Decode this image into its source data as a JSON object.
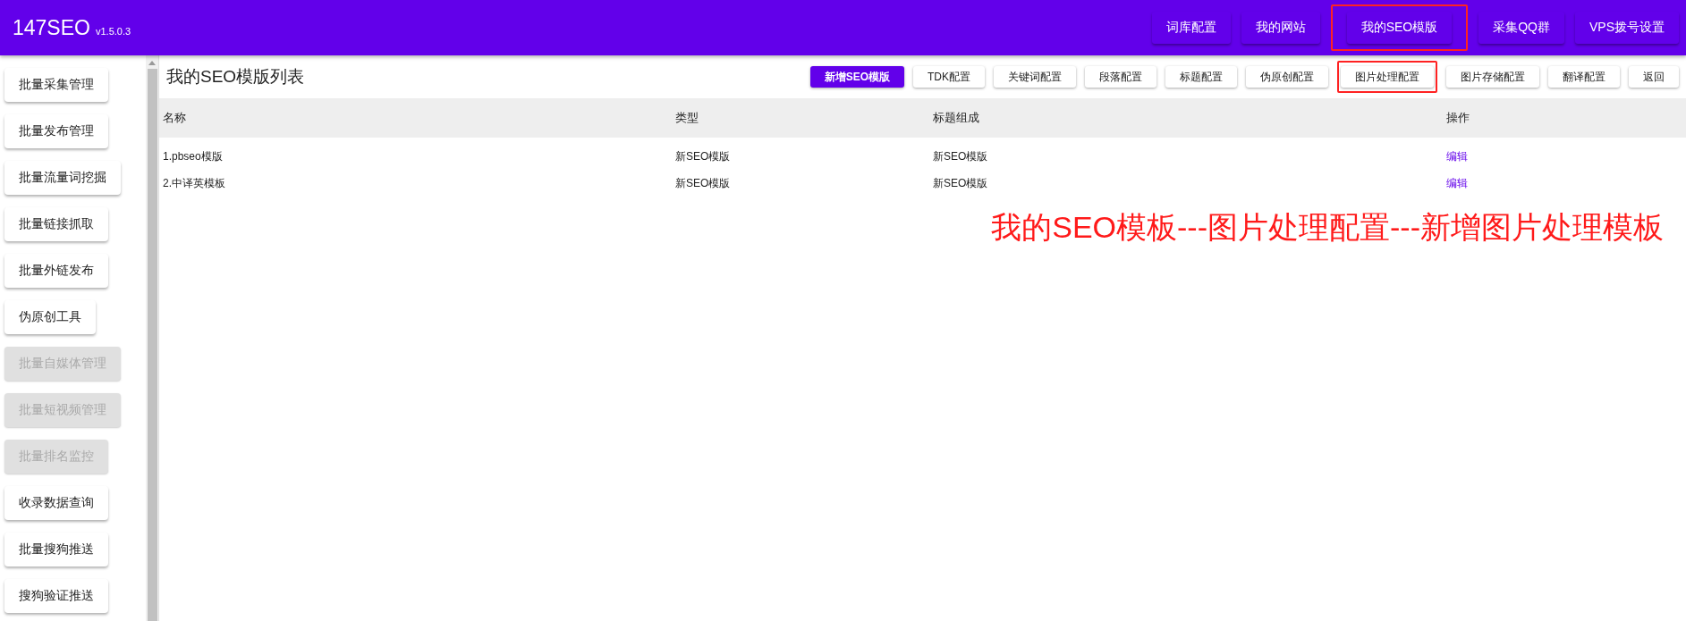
{
  "app": {
    "name": "147SEO",
    "version": "v1.5.0.3"
  },
  "nav": [
    {
      "label": "词库配置",
      "highlighted": false
    },
    {
      "label": "我的网站",
      "highlighted": false
    },
    {
      "label": "我的SEO模版",
      "highlighted": true
    },
    {
      "label": "采集QQ群",
      "highlighted": false
    },
    {
      "label": "VPS拨号设置",
      "highlighted": false
    }
  ],
  "sidebar": {
    "items": [
      {
        "label": "批量采集管理",
        "disabled": false
      },
      {
        "label": "批量发布管理",
        "disabled": false
      },
      {
        "label": "批量流量词挖掘",
        "disabled": false
      },
      {
        "label": "批量链接抓取",
        "disabled": false
      },
      {
        "label": "批量外链发布",
        "disabled": false
      },
      {
        "label": "伪原创工具",
        "disabled": false
      },
      {
        "label": "批量自媒体管理",
        "disabled": true
      },
      {
        "label": "批量短视频管理",
        "disabled": true
      },
      {
        "label": "批量排名监控",
        "disabled": true
      },
      {
        "label": "收录数据查询",
        "disabled": false
      },
      {
        "label": "批量搜狗推送",
        "disabled": false
      },
      {
        "label": "搜狗验证推送",
        "disabled": false
      }
    ]
  },
  "page_title": "我的SEO模版列表",
  "toolbar": [
    {
      "label": "新增SEO模版",
      "kind": "primary",
      "highlighted": false
    },
    {
      "label": "TDK配置",
      "kind": "plain",
      "highlighted": false
    },
    {
      "label": "关键词配置",
      "kind": "plain",
      "highlighted": false
    },
    {
      "label": "段落配置",
      "kind": "plain",
      "highlighted": false
    },
    {
      "label": "标题配置",
      "kind": "plain",
      "highlighted": false
    },
    {
      "label": "伪原创配置",
      "kind": "plain",
      "highlighted": false
    },
    {
      "label": "图片处理配置",
      "kind": "plain",
      "highlighted": true
    },
    {
      "label": "图片存储配置",
      "kind": "plain",
      "highlighted": false
    },
    {
      "label": "翻译配置",
      "kind": "plain",
      "highlighted": false
    },
    {
      "label": "返回",
      "kind": "plain",
      "highlighted": false
    }
  ],
  "table": {
    "columns": [
      "名称",
      "类型",
      "标题组成",
      "操作"
    ],
    "rows": [
      {
        "name": "1.pbseo模版",
        "type": "新SEO模版",
        "title": "新SEO模版",
        "action": "编辑"
      },
      {
        "name": "2.中译英模板",
        "type": "新SEO模版",
        "title": "新SEO模版",
        "action": "编辑"
      }
    ]
  },
  "annotation": "我的SEO模板---图片处理配置---新增图片处理模板"
}
